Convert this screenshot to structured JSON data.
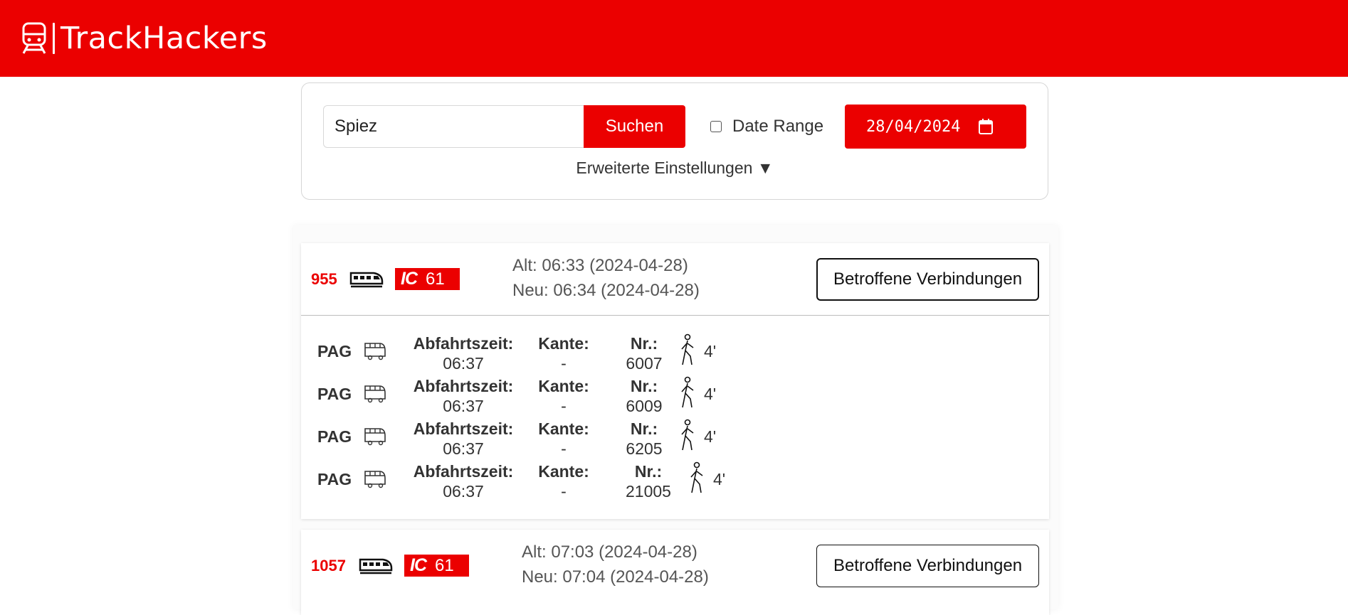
{
  "header": {
    "brand": "TrackHackers"
  },
  "search": {
    "value": "Spiez",
    "button": "Suchen",
    "range_label": "Date Range",
    "range_checked": false,
    "date": "28/04/2024",
    "advanced": "Erweiterte Einstellungen ▼"
  },
  "trains": [
    {
      "number": "955",
      "category": "IC",
      "line": "61",
      "alt": "Alt: 06:33 (2024-04-28)",
      "neu": "Neu: 06:34 (2024-04-28)",
      "button": "Betroffene Verbindungen",
      "connections": [
        {
          "operator": "PAG",
          "dep_label": "Abfahrtszeit:",
          "dep": "06:37",
          "edge_label": "Kante:",
          "edge": "-",
          "nr_label": "Nr.:",
          "nr": "6007",
          "walk": "4'"
        },
        {
          "operator": "PAG",
          "dep_label": "Abfahrtszeit:",
          "dep": "06:37",
          "edge_label": "Kante:",
          "edge": "-",
          "nr_label": "Nr.:",
          "nr": "6009",
          "walk": "4'"
        },
        {
          "operator": "PAG",
          "dep_label": "Abfahrtszeit:",
          "dep": "06:37",
          "edge_label": "Kante:",
          "edge": "-",
          "nr_label": "Nr.:",
          "nr": "6205",
          "walk": "4'"
        },
        {
          "operator": "PAG",
          "dep_label": "Abfahrtszeit:",
          "dep": "06:37",
          "edge_label": "Kante:",
          "edge": "-",
          "nr_label": "Nr.:",
          "nr": "21005",
          "walk": "4'"
        }
      ]
    },
    {
      "number": "1057",
      "category": "IC",
      "line": "61",
      "alt": "Alt: 07:03 (2024-04-28)",
      "neu": "Neu: 07:04 (2024-04-28)",
      "button": "Betroffene Verbindungen"
    }
  ],
  "colors": {
    "brand": "#eb0000"
  }
}
